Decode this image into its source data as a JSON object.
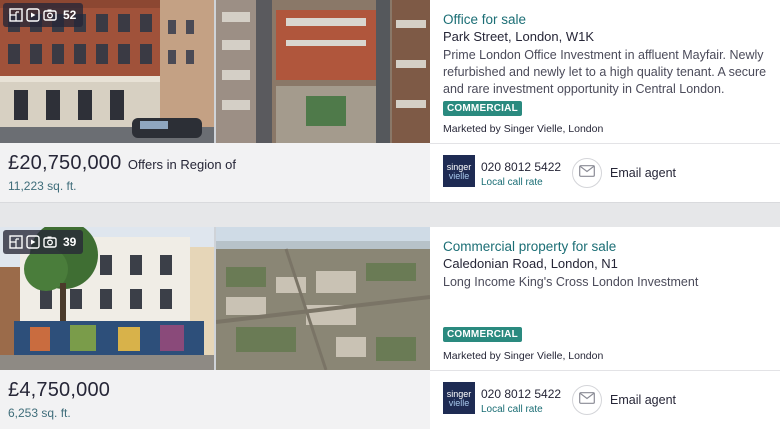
{
  "colors": {
    "accent": "#1b6e75",
    "tag_bg": "#2a8a7f",
    "text": "#262637",
    "price_bg": "#f2f2f3",
    "agent_logo_bg": "#1e2b53"
  },
  "listings": [
    {
      "media": {
        "photo_count": "52",
        "icons": [
          "floorplan-icon",
          "video-icon",
          "camera-icon"
        ]
      },
      "price": "£20,750,000",
      "price_qualifier": "Offers in Region of",
      "size": "11,223 sq. ft.",
      "title": "Office for sale",
      "address": "Park Street, London, W1K",
      "description": "Prime London Office Investment in affluent Mayfair. Newly refurbished and newly let to a high quality tenant. A secure and rare investment opportunity in Central London.",
      "tag": "COMMERCIAL",
      "marketed_by": "Marketed by Singer Vielle, London",
      "agent_logo": {
        "line1": "singer",
        "line2": "vielle"
      },
      "phone": "020 8012 5422",
      "phone_note": "Local call rate",
      "email_label": "Email agent"
    },
    {
      "media": {
        "photo_count": "39",
        "icons": [
          "floorplan-icon",
          "video-icon",
          "camera-icon"
        ]
      },
      "price": "£4,750,000",
      "price_qualifier": "",
      "size": "6,253 sq. ft.",
      "title": "Commercial property for sale",
      "address": "Caledonian Road, London, N1",
      "description": "Long Income King's Cross London Investment",
      "tag": "COMMERCIAL",
      "marketed_by": "Marketed by Singer Vielle, London",
      "agent_logo": {
        "line1": "singer",
        "line2": "vielle"
      },
      "phone": "020 8012 5422",
      "phone_note": "Local call rate",
      "email_label": "Email agent"
    }
  ]
}
